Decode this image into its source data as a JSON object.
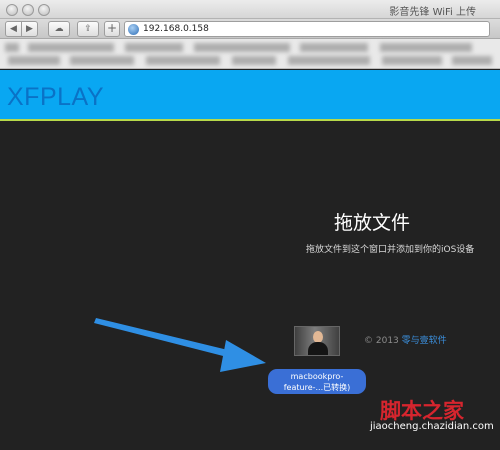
{
  "window": {
    "title": "影音先锋 WiFi 上传"
  },
  "toolbar": {
    "back_glyph": "◀",
    "forward_glyph": "▶",
    "cloud_glyph": "☁",
    "share_glyph": "⇪",
    "new_tab_glyph": "+",
    "url": "192.168.0.158"
  },
  "header": {
    "logo": "XFPLAY"
  },
  "main": {
    "drop_title": "拖放文件",
    "drop_subtitle": "拖放文件到这个窗口并添加到你的iOS设备",
    "copyright_prefix": "© 2013",
    "copyright_link": "零与壹软件"
  },
  "dragged_file": {
    "line1": "macbookpro-",
    "line2": "feature-...已转换)"
  },
  "watermark": {
    "main": "脚本之家",
    "sub": "jiaocheng.chazidian.com"
  },
  "icons": {
    "globe": "globe-icon",
    "cloud": "icloud-icon",
    "share": "share-icon"
  },
  "colors": {
    "header_blue": "#09a7f2",
    "logo_blue": "#0a72c6",
    "accent_line": "#b7d94a",
    "arrow_blue": "#2f8fe4",
    "label_blue": "#3a6fd6",
    "watermark_red": "#d6252e"
  }
}
